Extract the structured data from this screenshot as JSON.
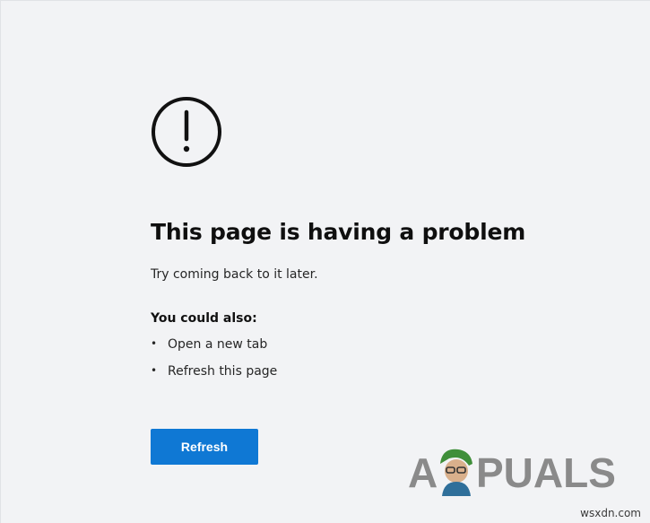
{
  "error": {
    "icon": "exclamation-circle-icon",
    "title": "This page is having a problem",
    "subtitle": "Try coming back to it later.",
    "also_heading": "You could also:",
    "options": [
      {
        "bullet": "•",
        "label": "Open a new tab"
      },
      {
        "bullet": "•",
        "label": "Refresh this page"
      }
    ]
  },
  "refresh_button": {
    "label": "Refresh",
    "color": "#0f78d4"
  },
  "watermark": {
    "brand": "APPUALS",
    "letters_before": "A",
    "letters_after": "PUALS"
  },
  "credit": "wsxdn.com",
  "colors": {
    "background": "#f2f3f5",
    "text": "#111111",
    "accent": "#0f78d4"
  }
}
